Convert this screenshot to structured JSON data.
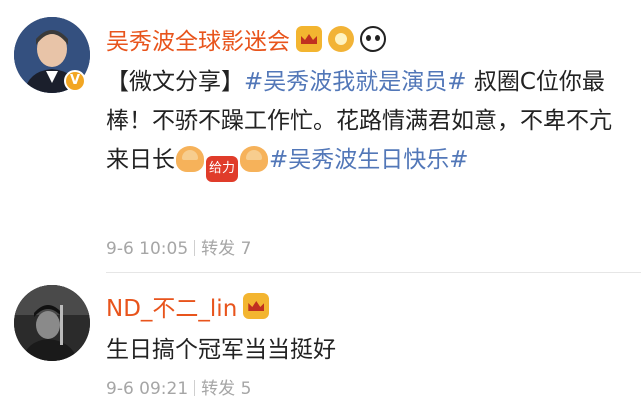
{
  "posts": [
    {
      "author": "吴秀波全球影迷会",
      "content_lead": "【微文分享】",
      "topic1": "#吴秀波我就是演员#",
      "text1": " 叔圈C位你最棒！不骄不躁工作忙。花路情满君如意，不卑不亢来日长",
      "bubble_emoji": "给力",
      "topic2": "#吴秀波生日快乐#",
      "time": "9-6 10:05",
      "reposts": "转发 7",
      "verified_mark": "V",
      "badges": [
        "crown-badge",
        "medal-badge",
        "panda-badge"
      ]
    },
    {
      "author": "ND_不二_lin",
      "content": "生日搞个冠军当当挺好",
      "time": "9-6 09:21",
      "reposts": "转发 5",
      "badges": [
        "crown-badge"
      ]
    }
  ],
  "colors": {
    "author_name": "#e8541c",
    "topic": "#5277b8",
    "meta": "#a6a6a6"
  }
}
